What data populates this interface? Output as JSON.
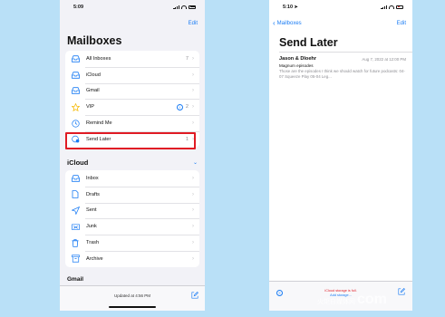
{
  "left": {
    "status": {
      "time": "5:09"
    },
    "edit_label": "Edit",
    "title": "Mailboxes",
    "mailboxes": [
      {
        "label": "All Inboxes",
        "count": "7",
        "icon": "tray-icon"
      },
      {
        "label": "iCloud",
        "count": "",
        "icon": "tray-icon"
      },
      {
        "label": "Gmail",
        "count": "",
        "icon": "tray-icon"
      },
      {
        "label": "VIP",
        "count": "2",
        "icon": "star-icon"
      },
      {
        "label": "Remind Me",
        "count": "",
        "icon": "clock-icon"
      },
      {
        "label": "Send Later",
        "count": "1",
        "icon": "send-later-icon"
      }
    ],
    "icloud_section": {
      "title": "iCloud",
      "items": [
        {
          "label": "Inbox",
          "icon": "tray-icon"
        },
        {
          "label": "Drafts",
          "icon": "document-icon"
        },
        {
          "label": "Sent",
          "icon": "paperplane-icon"
        },
        {
          "label": "Junk",
          "icon": "junk-icon"
        },
        {
          "label": "Trash",
          "icon": "trash-icon"
        },
        {
          "label": "Archive",
          "icon": "archive-icon"
        }
      ]
    },
    "next_section_title": "Gmail",
    "updated_text": "Updated at 4:56 PM"
  },
  "right": {
    "status": {
      "time": "5:10"
    },
    "back_label": "Mailboxes",
    "edit_label": "Edit",
    "title": "Send Later",
    "message": {
      "from": "Jason & Dloehr",
      "date": "Aug 7, 2022 at 12:00 PM",
      "subject": "Magnum episodes",
      "preview": "Those are the episodes I think we should watch for future podcasts: 04-07 Squeeze Play 05-04 Leg..."
    },
    "storage_line1": "iCloud storage is full.",
    "storage_line2": "Add storage..."
  },
  "colors": {
    "accent": "#1a7cf4",
    "highlight": "#e01b24",
    "background": "#b9e0f7"
  },
  "watermark": {
    "small": "火炬自媒体网",
    "big": "com"
  }
}
